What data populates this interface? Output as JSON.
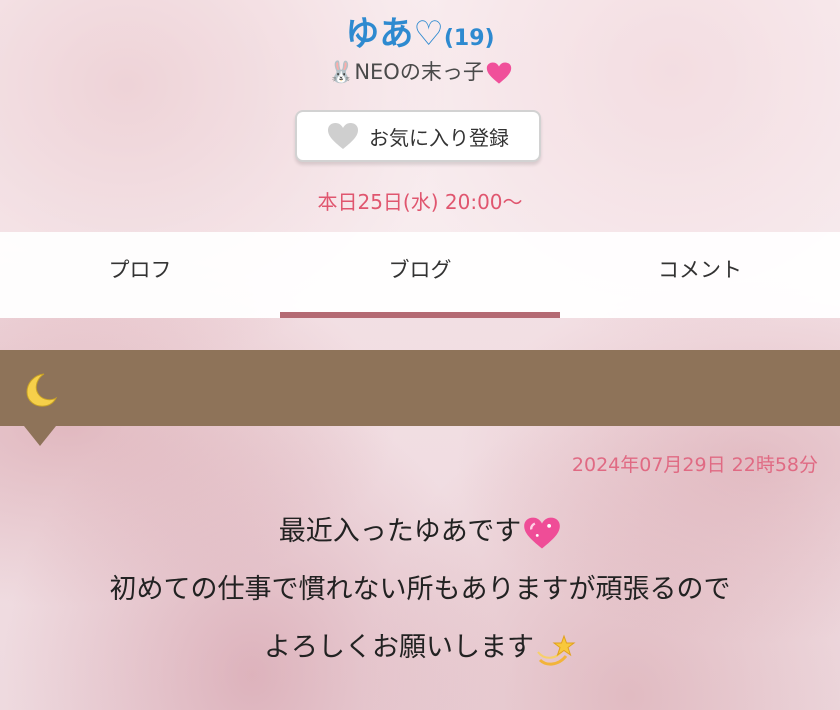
{
  "profile": {
    "name": "ゆあ♡",
    "age": "(19)",
    "subtitle_pre": "🐰NEOの末っ子",
    "favorite_label": "お気に入り登録",
    "schedule": "本日25日(水) 20:00〜"
  },
  "tabs": [
    {
      "label": "プロフ",
      "active": false
    },
    {
      "label": "ブログ",
      "active": true
    },
    {
      "label": "コメント",
      "active": false
    }
  ],
  "blog": {
    "header_icon": "crescent-moon-icon",
    "date": "2024年07月29日 22時58分",
    "line1": "最近入ったゆあです",
    "line2": "初めての仕事で慣れない所もありますが頑張るので",
    "line3": "よろしくお願いします"
  },
  "colors": {
    "name": "#2e8ad0",
    "schedule": "#e0566f",
    "tab_indicator": "#b46a73",
    "blog_header": "#8e7359",
    "date": "#e06a83"
  }
}
